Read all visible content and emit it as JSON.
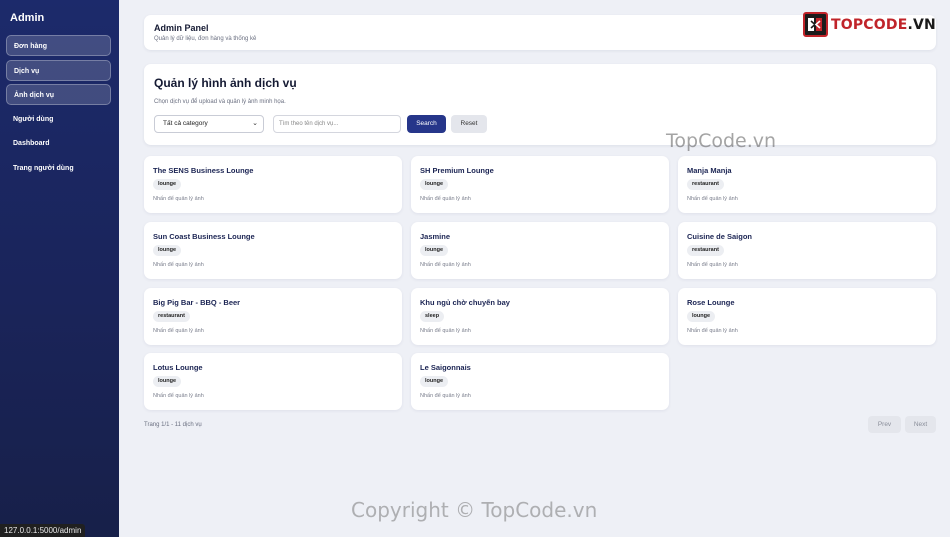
{
  "sidebar": {
    "brand": "Admin",
    "items": [
      {
        "label": "Đơn hàng"
      },
      {
        "label": "Dịch vụ"
      },
      {
        "label": "Ảnh dịch vụ"
      },
      {
        "label": "Người dùng"
      },
      {
        "label": "Dashboard"
      },
      {
        "label": "Trang người dùng"
      }
    ]
  },
  "header": {
    "title": "Admin Panel",
    "subtitle": "Quản lý dữ liệu, đơn hàng và thống kê"
  },
  "logo": {
    "text_red": "TOPCODE",
    "text_dark": ".VN",
    "icon": "topcode-logo-icon"
  },
  "filter": {
    "title": "Quản lý hình ảnh dịch vụ",
    "subtitle": "Chọn dịch vụ để upload và quản lý ảnh minh họa.",
    "category_selected": "Tất cả category",
    "search_placeholder": "Tìm theo tên dịch vụ...",
    "search_label": "Search",
    "reset_label": "Reset"
  },
  "services": [
    {
      "name": "The SENS Business Lounge",
      "tag": "lounge",
      "hint": "Nhấn để quản lý ảnh"
    },
    {
      "name": "SH Premium Lounge",
      "tag": "lounge",
      "hint": "Nhấn để quản lý ảnh"
    },
    {
      "name": "Manja Manja",
      "tag": "restaurant",
      "hint": "Nhấn để quản lý ảnh"
    },
    {
      "name": "Sun Coast Business Lounge",
      "tag": "lounge",
      "hint": "Nhấn để quản lý ảnh"
    },
    {
      "name": "Jasmine",
      "tag": "lounge",
      "hint": "Nhấn để quản lý ảnh"
    },
    {
      "name": "Cuisine de Saigon",
      "tag": "restaurant",
      "hint": "Nhấn để quản lý ảnh"
    },
    {
      "name": "Big Pig Bar - BBQ - Beer",
      "tag": "restaurant",
      "hint": "Nhấn để quản lý ảnh"
    },
    {
      "name": "Khu ngủ chờ chuyến bay",
      "tag": "sleep",
      "hint": "Nhấn để quản lý ảnh"
    },
    {
      "name": "Rose Lounge",
      "tag": "lounge",
      "hint": "Nhấn để quản lý ảnh"
    },
    {
      "name": "Lotus Lounge",
      "tag": "lounge",
      "hint": "Nhấn để quản lý ảnh"
    },
    {
      "name": "Le Saigonnais",
      "tag": "lounge",
      "hint": "Nhấn để quản lý ảnh"
    }
  ],
  "pagination": {
    "info": "Trang 1/1 - 11 dịch vụ",
    "prev_label": "Prev",
    "next_label": "Next"
  },
  "watermarks": {
    "middle": "TopCode.vn",
    "bottom": "Copyright © TopCode.vn"
  },
  "status_bar": {
    "url": "127.0.0.1:5000/admin"
  },
  "colors": {
    "sidebar": "#1c2a6b",
    "accent": "#26368a",
    "logo_red": "#c0242a",
    "background": "#eef0f6"
  }
}
